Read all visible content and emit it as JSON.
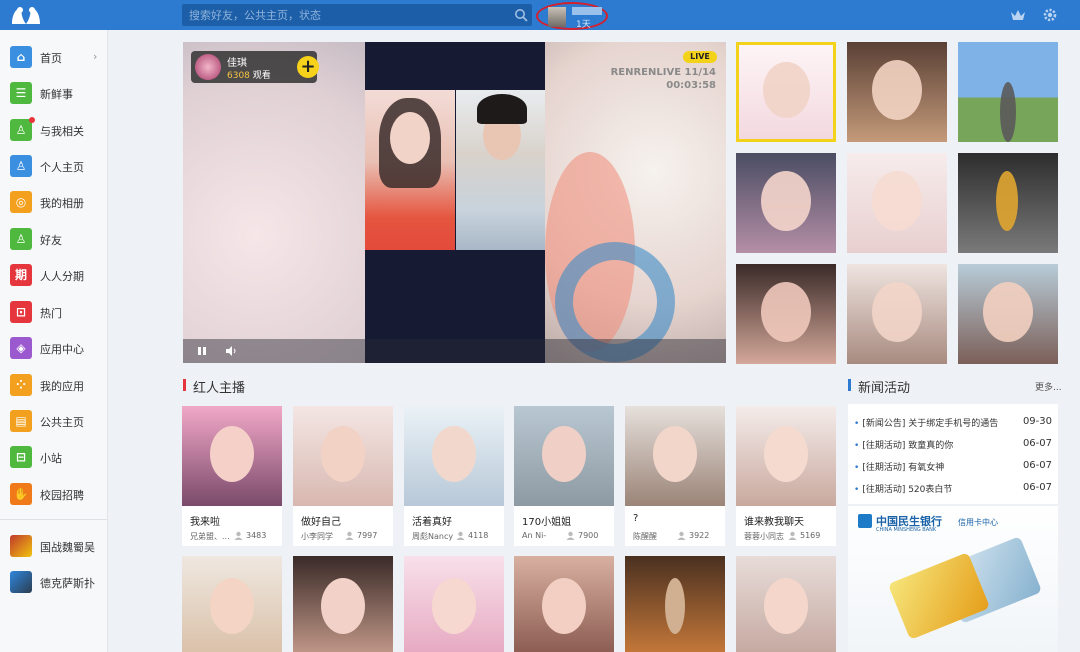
{
  "search": {
    "placeholder": "搜索好友，公共主页，状态"
  },
  "user": {
    "days": "1天"
  },
  "sidebar": {
    "items": [
      {
        "label": "首页",
        "color": "#3a8fe0"
      },
      {
        "label": "新鲜事",
        "color": "#4fb83f"
      },
      {
        "label": "与我相关",
        "color": "#4fb83f"
      },
      {
        "label": "个人主页",
        "color": "#3a8fe0"
      },
      {
        "label": "我的相册",
        "color": "#f2a01e"
      },
      {
        "label": "好友",
        "color": "#4fb83f"
      },
      {
        "label": "人人分期",
        "color": "#e5353d"
      },
      {
        "label": "热门",
        "color": "#e5353d"
      },
      {
        "label": "应用中心",
        "color": "#9b59d0"
      },
      {
        "label": "我的应用",
        "color": "#f2a01e"
      },
      {
        "label": "公共主页",
        "color": "#f2a01e"
      },
      {
        "label": "小站",
        "color": "#4fb83f"
      },
      {
        "label": "校园招聘",
        "color": "#f07a1a"
      }
    ],
    "games": [
      {
        "label": "国战魏蜀吴"
      },
      {
        "label": "德克萨斯扑"
      }
    ]
  },
  "live": {
    "host_name": "佳琪",
    "viewers": "6308",
    "viewers_label": "观看",
    "badge": "LIVE",
    "brand": "RENRENLIVE 11/14",
    "time": "00:03:58"
  },
  "sections": {
    "hot_title": "红人主播",
    "news_title": "新闻活动",
    "more": "更多..."
  },
  "cards": [
    {
      "title": "我来啦",
      "user": "兄弟盟、...",
      "views": "3483"
    },
    {
      "title": "做好自己",
      "user": "小李同学",
      "views": "7997"
    },
    {
      "title": "活着真好",
      "user": "周彪Nancy",
      "views": "4118"
    },
    {
      "title": "170小姐姐",
      "user": "An Ni-",
      "views": "7900"
    },
    {
      "title": "?",
      "user": "陈醒醒",
      "views": "3922"
    },
    {
      "title": "谁来教我聊天",
      "user": "蓉蓉小同志",
      "views": "5169"
    }
  ],
  "news": [
    {
      "text": "[新闻公告] 关于绑定手机号的通告",
      "date": "09-30"
    },
    {
      "text": "[往期活动] 致童真的你",
      "date": "06-07"
    },
    {
      "text": "[往期活动] 有氧女神",
      "date": "06-07"
    },
    {
      "text": "[往期活动] 520表白节",
      "date": "06-07"
    }
  ],
  "ad": {
    "bank_cn": "中国民生银行",
    "bank_en": "CHINA MINSHENG BANK",
    "bank_sub": "信用卡中心"
  },
  "colors": {
    "topbar": "#2c7bd0",
    "accent_red": "#e5353d",
    "accent_blue": "#2c7bd0"
  }
}
